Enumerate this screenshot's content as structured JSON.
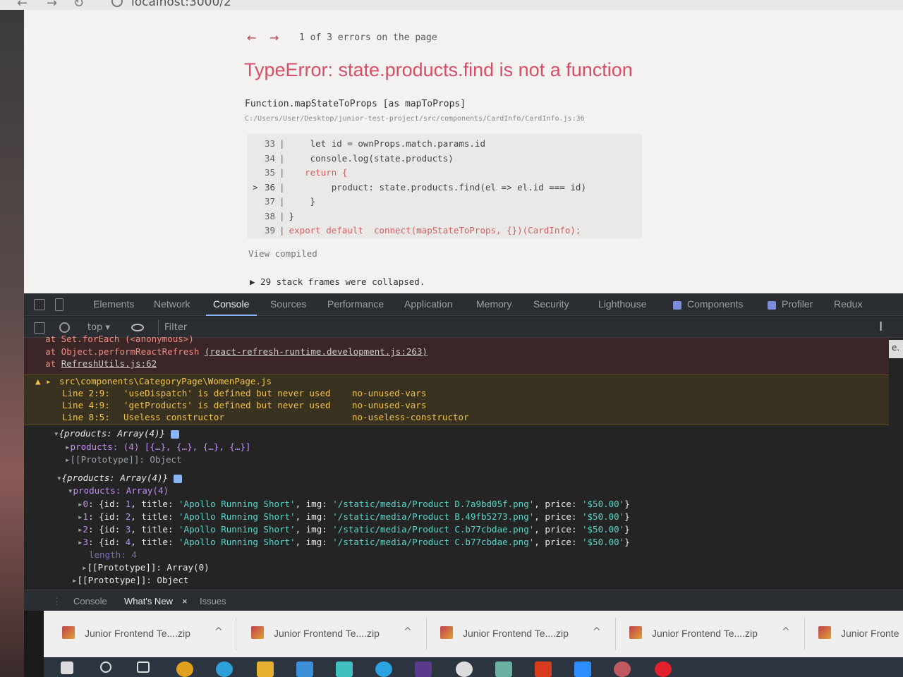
{
  "browser": {
    "url": "localhost:3000/2"
  },
  "error_overlay": {
    "nav_back": "←",
    "nav_forward": "→",
    "error_count": "1 of 3 errors on the page",
    "title": "TypeError: state.products.find is not a function",
    "function_name": "Function.mapStateToProps [as mapToProps]",
    "file_path": "C:/Users/User/Desktop/junior-test-project/src/components/CardInfo/CardInfo.js:36",
    "code_lines": [
      {
        "num": "33",
        "marker": "",
        "code": "    let id = ownProps.match.params.id"
      },
      {
        "num": "34",
        "marker": "",
        "code": "    console.log(state.products)"
      },
      {
        "num": "35",
        "marker": "",
        "code": "   return {"
      },
      {
        "num": "36",
        "marker": ">",
        "code": "        product: state.products.find(el => el.id === id)"
      },
      {
        "num": "37",
        "marker": "",
        "code": "    }"
      },
      {
        "num": "38",
        "marker": "",
        "code": "}"
      },
      {
        "num": "39",
        "marker": "",
        "code": "export default  connect(mapStateToProps, {})(CardInfo);"
      }
    ],
    "view_compiled": "View compiled",
    "stack_collapsed": "▶ 29 stack frames were collapsed."
  },
  "devtools": {
    "tabs": [
      "Elements",
      "Network",
      "Console",
      "Sources",
      "Performance",
      "Application",
      "Memory",
      "Security",
      "Lighthouse",
      "Components",
      "Profiler",
      "Redux"
    ],
    "active_tab": "Console",
    "context": "top ▾",
    "filter_placeholder": "Filter",
    "side_label": "e.",
    "console": {
      "error_lines": [
        "    at Set.forEach (<anonymous>)",
        "    at Object.performReactRefresh ",
        "(react-refresh-runtime.development.js:263)",
        "    at ",
        "RefreshUtils.js:62"
      ],
      "warning": {
        "file": "src\\components\\CategoryPage\\WomenPage.js",
        "rows": [
          {
            "loc": "Line 2:9:",
            "msg": "'useDispatch' is defined but never used",
            "rule": "no-unused-vars"
          },
          {
            "loc": "Line 4:9:",
            "msg": "'getProducts' is defined but never used",
            "rule": "no-unused-vars"
          },
          {
            "loc": "Line 8:5:",
            "msg": "Useless constructor",
            "rule": "no-useless-constructor"
          }
        ]
      },
      "obj1": {
        "header": "{products: Array(4)}",
        "products_line": "products: (4) [{…}, {…}, {…}, {…}]",
        "proto": "[[Prototype]]: Object"
      },
      "obj2": {
        "header": "{products: Array(4)}",
        "products_key": "products: Array(4)",
        "items": [
          {
            "idx": "0",
            "id": "1",
            "title": "'Apollo Running Short'",
            "img": "'/static/media/Product D.7a9bd05f.png'",
            "price": "'$50.00'"
          },
          {
            "idx": "1",
            "id": "2",
            "title": "'Apollo Running Short'",
            "img": "'/static/media/Product B.49fb5273.png'",
            "price": "'$50.00'"
          },
          {
            "idx": "2",
            "id": "3",
            "title": "'Apollo Running Short'",
            "img": "'/static/media/Product C.b77cbdae.png'",
            "price": "'$50.00'"
          },
          {
            "idx": "3",
            "id": "4",
            "title": "'Apollo Running Short'",
            "img": "'/static/media/Product C.b77cbdae.png'",
            "price": "'$50.00'"
          }
        ],
        "length_line": "length: 4",
        "array_proto": "[[Prototype]]: Array(0)",
        "obj_proto": "[[Prototype]]: Object"
      }
    },
    "drawer_tabs": [
      "Console",
      "What's New",
      "Issues"
    ],
    "drawer_close": "×"
  },
  "downloads": [
    "Junior Frontend Te....zip",
    "Junior Frontend Te....zip",
    "Junior Frontend Te....zip",
    "Junior Frontend Te....zip",
    "Junior Fronte"
  ],
  "colors": {
    "error_title": "#d64f66",
    "devtools_bg": "#242424",
    "warning": "#f2c34a",
    "accent": "#8ab4f8"
  }
}
